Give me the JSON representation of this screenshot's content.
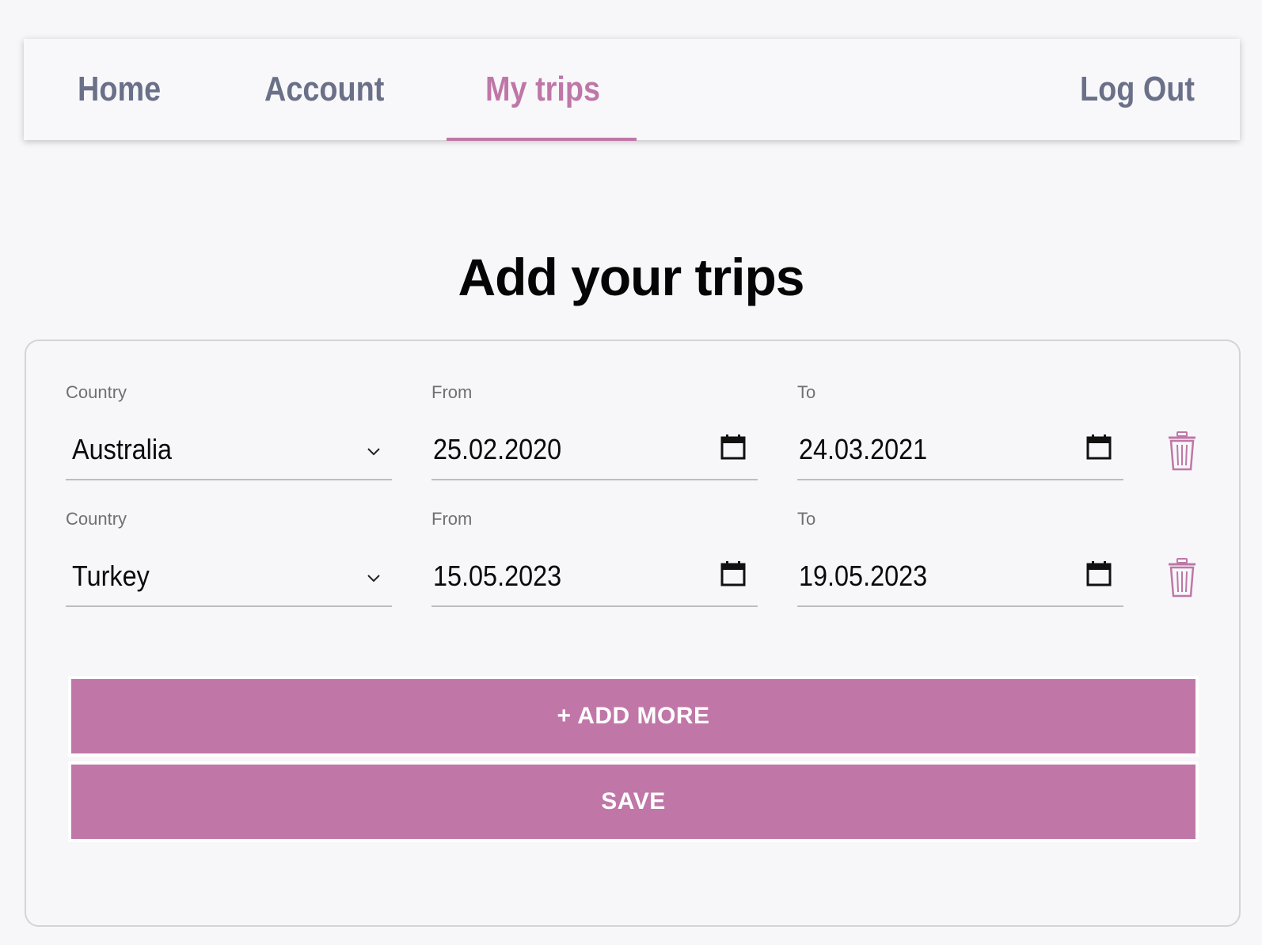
{
  "nav": {
    "home": "Home",
    "account": "Account",
    "my_trips": "My trips",
    "log_out": "Log Out",
    "active": "My trips"
  },
  "page_title": "Add your trips",
  "trips": [
    {
      "country_label": "Country",
      "country": "Australia",
      "from_label": "From",
      "from": "25.02.2020",
      "to_label": "To",
      "to": "24.03.2021"
    },
    {
      "country_label": "Country",
      "country": "Turkey",
      "from_label": "From",
      "from": "15.05.2023",
      "to_label": "To",
      "to": "19.05.2023"
    }
  ],
  "buttons": {
    "add_more": "+ ADD MORE",
    "save": "SAVE"
  },
  "icons": {
    "dropdown": "chevron-down-icon",
    "calendar": "calendar-icon",
    "delete": "trash-icon"
  },
  "colors": {
    "accent": "#bf77a7",
    "nav_text": "#6b7089",
    "background": "#f7f7f9"
  }
}
